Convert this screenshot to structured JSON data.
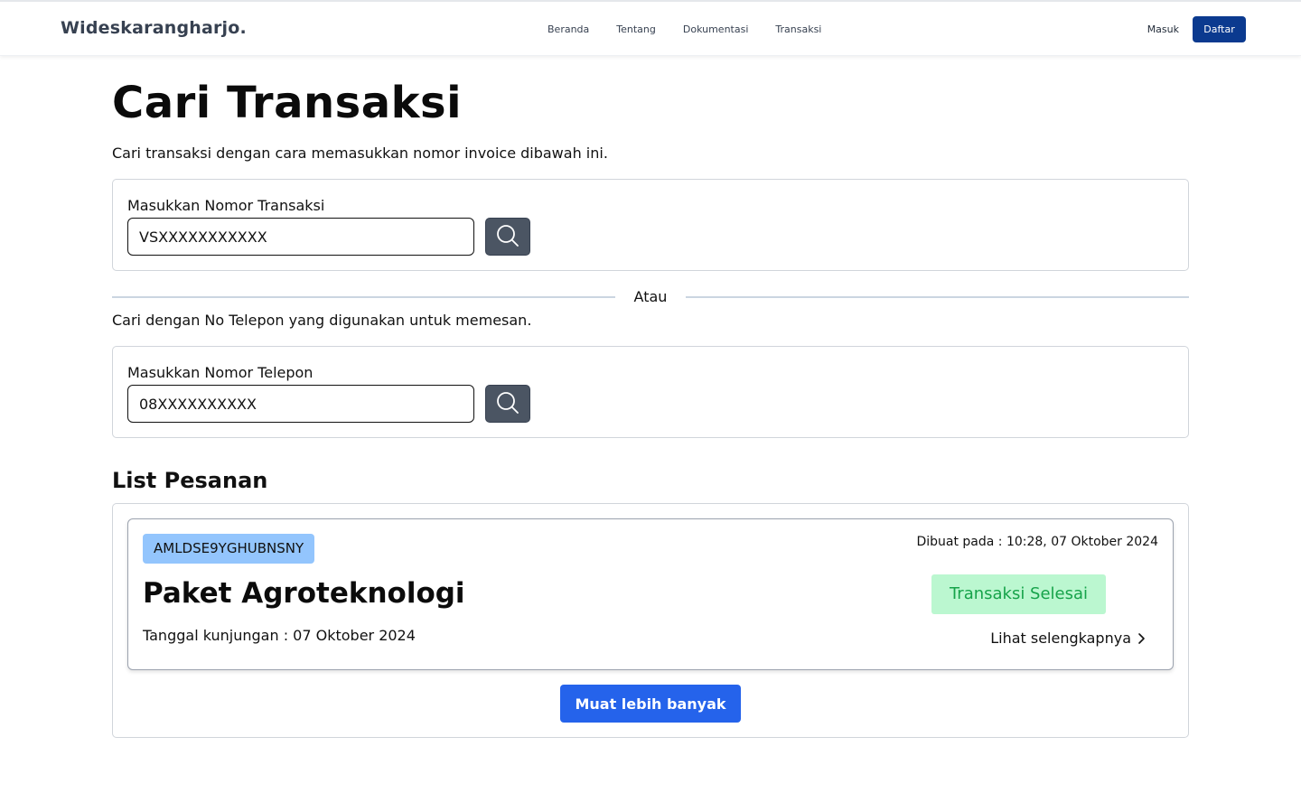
{
  "navbar": {
    "brand": "Wideskarangharjo.",
    "links": [
      "Beranda",
      "Tentang",
      "Dokumentasi",
      "Transaksi"
    ],
    "login_label": "Masuk",
    "register_label": "Daftar"
  },
  "header": {
    "title": "Cari Transaksi",
    "subtitle": "Cari transaksi dengan cara memasukkan nomor invoice dibawah ini."
  },
  "invoice_search": {
    "label": "Masukkan Nomor Transaksi",
    "value": "VSXXXXXXXXXXX",
    "button_icon": "search-icon"
  },
  "divider": {
    "text": "Atau"
  },
  "phone_search": {
    "hint": "Cari dengan No Telepon yang digunakan untuk memesan.",
    "label": "Masukkan Nomor Telepon",
    "value": "08XXXXXXXXXX",
    "button_icon": "search-icon"
  },
  "orders": {
    "title": "List Pesanan",
    "items": [
      {
        "code": "AMLDSE9YGHUBNSNY",
        "name": "Paket Agroteknologi",
        "visit_date": "Tanggal kunjungan : 07 Oktober 2024",
        "created_at": "Dibuat pada : 10:28, 07 Oktober 2024",
        "status": "Transaksi Selesai",
        "detail_label": "Lihat selengkapnya"
      }
    ],
    "load_more_label": "Muat lebih banyak"
  },
  "colors": {
    "brand_blue": "#0b3a8f",
    "primary_blue": "#2563eb",
    "search_button": "#4b5563",
    "code_badge": "#93c5fd",
    "status_bg": "#bbf7d0",
    "status_text": "#16a34a"
  }
}
